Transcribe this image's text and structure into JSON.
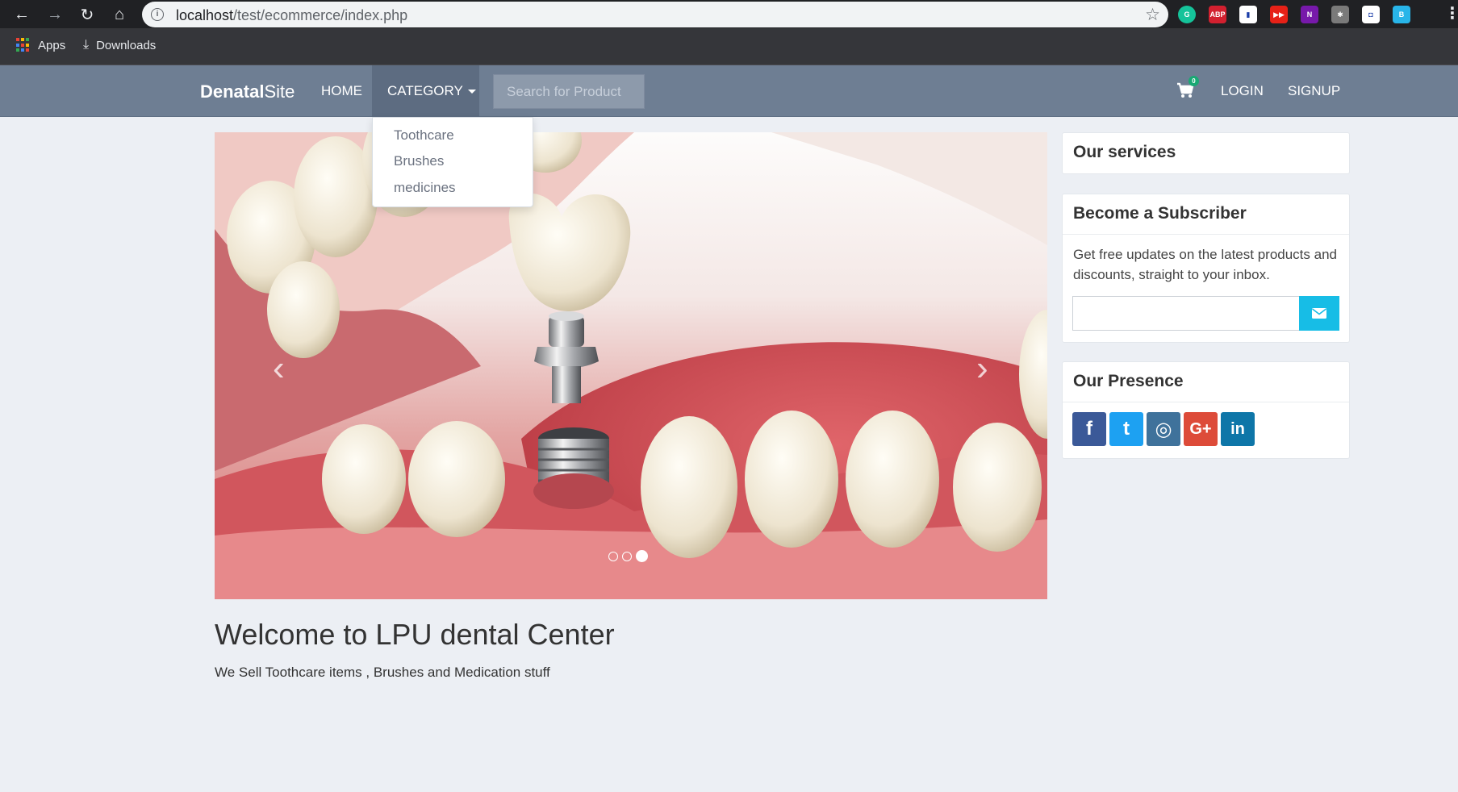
{
  "browser": {
    "url_host": "localhost",
    "url_path": "/test/ecommerce/index.php",
    "bookmarks": [
      {
        "label": "Apps",
        "icon": "apps-grid-icon"
      },
      {
        "label": "Downloads",
        "icon": "download-icon"
      }
    ],
    "extensions": [
      {
        "name": "grammarly-icon",
        "color": "#15c39a",
        "text": "G"
      },
      {
        "name": "adblock-plus-icon",
        "color": "#d2202f",
        "text": "ABP"
      },
      {
        "name": "extension-icon",
        "color": "#ffffff",
        "text": "▮"
      },
      {
        "name": "youtube-icon",
        "color": "#e62117",
        "text": "▶▶"
      },
      {
        "name": "onenote-icon",
        "color": "#7719aa",
        "text": "N"
      },
      {
        "name": "puzzle-icon",
        "color": "#7a7a7a",
        "text": "✱"
      },
      {
        "name": "screen-capture-icon",
        "color": "#ffffff",
        "text": "◘"
      },
      {
        "name": "bookmark-ext-icon",
        "color": "#28b5e9",
        "text": "B"
      }
    ]
  },
  "nav": {
    "brand_bold": "Denatal",
    "brand_rest": "Site",
    "home": "HOME",
    "category": "CATEGORY",
    "search_placeholder": "Search for Product",
    "cart_count": "0",
    "login": "LOGIN",
    "signup": "SIGNUP"
  },
  "dropdown": {
    "items": [
      "Toothcare",
      "Brushes",
      "medicines"
    ]
  },
  "carousel": {
    "prev": "‹",
    "next": "›",
    "slide_count": 3,
    "active_index": 2
  },
  "welcome": {
    "title": "Welcome to LPU dental Center",
    "text": "We Sell Toothcare items , Brushes and Medication stuff"
  },
  "sidebar": {
    "services_title": "Our services",
    "subscriber_title": "Become a Subscriber",
    "subscriber_text": "Get free updates on the latest products and discounts, straight to your inbox.",
    "presence_title": "Our Presence",
    "socials": [
      {
        "name": "facebook-icon",
        "glyph": "f",
        "color": "#3b5998"
      },
      {
        "name": "twitter-icon",
        "glyph": "t",
        "color": "#1da1f2"
      },
      {
        "name": "instagram-icon",
        "glyph": "◎",
        "color": "#3f729b"
      },
      {
        "name": "google-plus-icon",
        "glyph": "G+",
        "color": "#dd4b39"
      },
      {
        "name": "linkedin-icon",
        "glyph": "in",
        "color": "#0e76a8"
      }
    ]
  }
}
